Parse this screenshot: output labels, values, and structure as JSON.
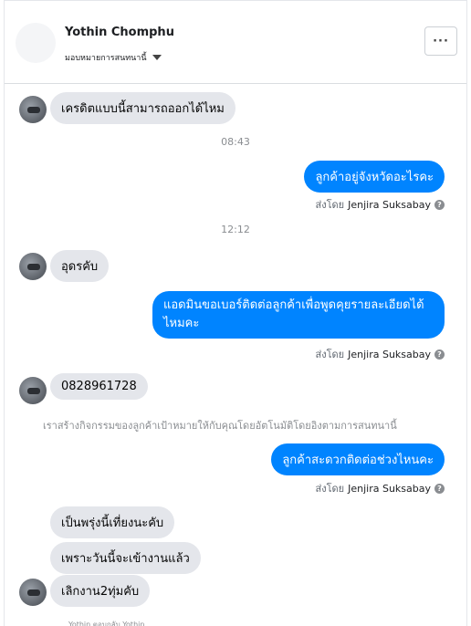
{
  "header": {
    "contact_name": "Yothin Chomphu",
    "assign_label": "มอบหมายการสนทนานี้",
    "more_label": "···"
  },
  "thread": {
    "msg1": "เครดิตแบบนี้สามารถออกได้ไหม",
    "time1": "08:43",
    "out1": "ลูกค้าอยู่จังหวัดอะไรคะ",
    "time2": "12:12",
    "msg2": "อุดรคับ",
    "out2": "แอดมินขอเบอร์ติดต่อลูกค้าเพื่อพูดคุยรายละเอียดได้ไหมคะ",
    "msg3": "0828961728",
    "notice": "เราสร้างกิจกรรมของลูกค้าเป้าหมายให้กับคุณโดยอัตโนมัติโดยอิงตามการสนทนานี้",
    "out3": "ลูกค้าสะดวกติดต่อช่วงไหนคะ",
    "msg4": "เป็นพรุ่งนี้เที่ยงนะคับ",
    "msg5": "เพราะวันนี้จะเข้างานแล้ว",
    "msg6": "เลิกงาน2ทุ่มคับ",
    "footer_note": "Yothin ตอบกลับ Yothin"
  },
  "sent_by": {
    "prefix": "ส่งโดย",
    "agent": "Jenjira Suksabay",
    "help_glyph": "?"
  },
  "colors": {
    "outgoing_bubble": "#0084ff",
    "incoming_bubble": "#e4e6eb"
  }
}
